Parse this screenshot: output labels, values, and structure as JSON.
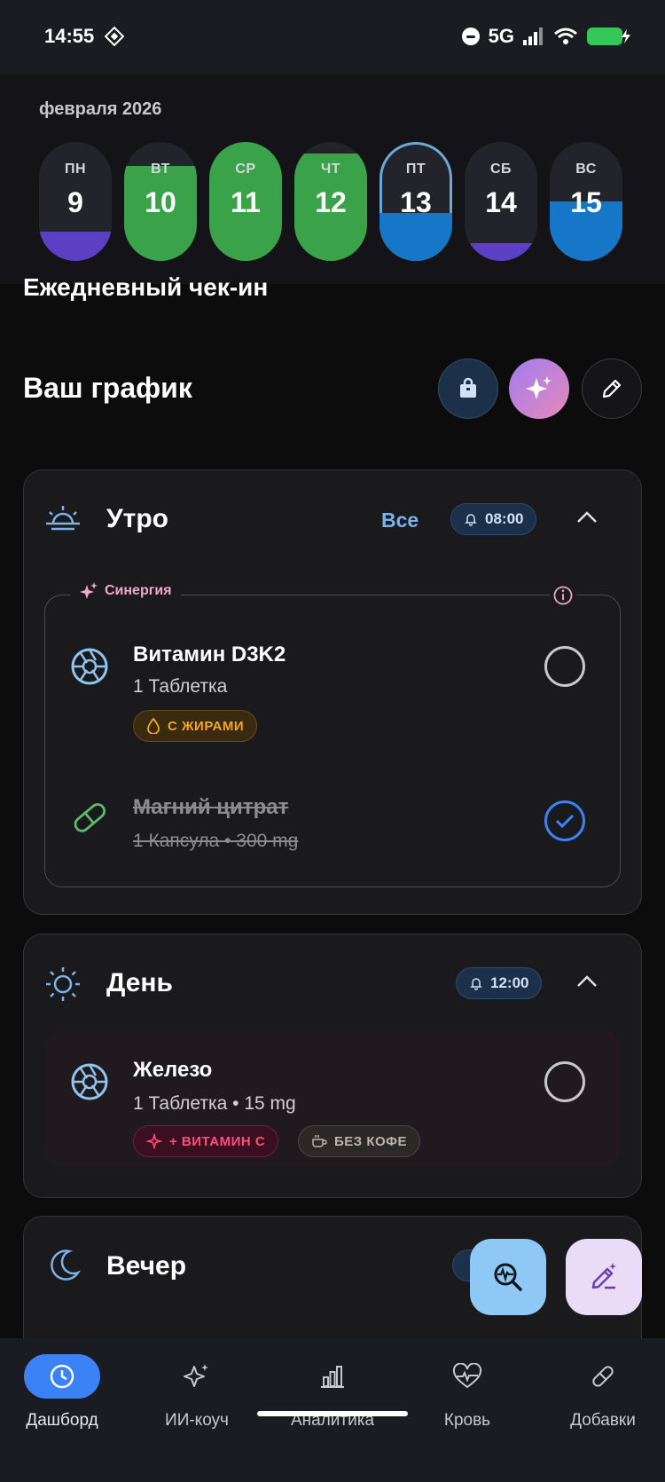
{
  "status_bar": {
    "time": "14:55",
    "network": "5G"
  },
  "calendar": {
    "month": "февраля 2026",
    "days": [
      {
        "name": "ПН",
        "num": "9",
        "fill_color": "#5b3fc4",
        "fill_fraction": 0.25,
        "bg": "#23242b"
      },
      {
        "name": "ВТ",
        "num": "10",
        "fill_color": "#3aa34a",
        "fill_fraction": 0.8,
        "bg": "#23242b"
      },
      {
        "name": "СР",
        "num": "11",
        "fill_color": "#3aa34a",
        "fill_fraction": 1.0,
        "bg": "#23242b"
      },
      {
        "name": "ЧТ",
        "num": "12",
        "fill_color": "#3aa34a",
        "fill_fraction": 0.9,
        "bg": "#23242b"
      },
      {
        "name": "ПТ",
        "num": "13",
        "fill_color": "#1677c8",
        "fill_fraction": 0.4,
        "bg": "#23242b",
        "selected": true
      },
      {
        "name": "СБ",
        "num": "14",
        "fill_color": "#5b3fc4",
        "fill_fraction": 0.15,
        "bg": "#23242b"
      },
      {
        "name": "ВС",
        "num": "15",
        "fill_color": "#1677c8",
        "fill_fraction": 0.5,
        "bg": "#23242b"
      }
    ]
  },
  "checkin": {
    "title": "Ежедневный чек-ин"
  },
  "schedule": {
    "title": "Ваш график"
  },
  "morning": {
    "title": "Утро",
    "all_label": "Все",
    "time": "08:00",
    "synergy_label": "Синергия",
    "items": [
      {
        "name": "Витамин D3K2",
        "sub": "1 Таблетка",
        "tag": "С ЖИРАМИ",
        "done": false
      },
      {
        "name": "Магний цитрат",
        "sub": "1 Капсула  •  300 mg",
        "done": true
      }
    ]
  },
  "day": {
    "title": "День",
    "time": "12:00",
    "items": [
      {
        "name": "Железо",
        "sub": "1 Таблетка  •  15 mg",
        "tags": [
          "+ ВИТАМИН С",
          "БЕЗ КОФЕ"
        ],
        "done": false
      }
    ]
  },
  "evening": {
    "title": "Вечер"
  },
  "nav": {
    "items": [
      {
        "label": "Дашборд",
        "icon": "clock-icon",
        "active": true
      },
      {
        "label": "ИИ-коуч",
        "icon": "sparkles-icon"
      },
      {
        "label": "Аналитика",
        "icon": "bar-chart-icon"
      },
      {
        "label": "Кровь",
        "icon": "heart-pulse-icon"
      },
      {
        "label": "Добавки",
        "icon": "pill-icon"
      }
    ]
  },
  "colors": {
    "accent": "#3b82f6",
    "success": "#3aa34a",
    "purple": "#5b3fc4",
    "blue_fill": "#1677c8"
  }
}
